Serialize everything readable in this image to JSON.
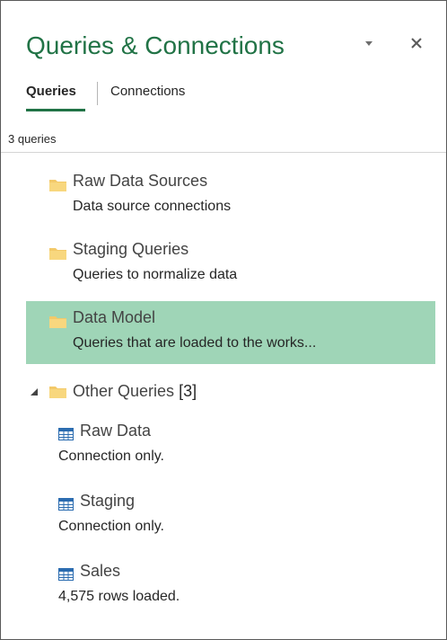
{
  "pane": {
    "title": "Queries & Connections",
    "dropdown_icon": "chevron-down-icon",
    "close_icon": "close-icon",
    "accent_color": "#217346",
    "selected_color": "#9fd5b7"
  },
  "tabs": {
    "queries_label": "Queries",
    "connections_label": "Connections",
    "active": "Queries"
  },
  "query_count": "3 queries",
  "groups": [
    {
      "name": "Raw Data Sources",
      "description": "Data source connections",
      "icon": "folder-icon",
      "selected": false
    },
    {
      "name": "Staging Queries",
      "description": "Queries to normalize data",
      "icon": "folder-icon",
      "selected": false
    },
    {
      "name": "Data Model",
      "description": "Queries that are loaded to the works...",
      "icon": "folder-icon",
      "selected": true
    }
  ],
  "other_group": {
    "name": "Other Queries",
    "count": "[3]",
    "expanded": true,
    "icon": "folder-icon"
  },
  "queries": [
    {
      "name": "Raw Data",
      "status": "Connection only.",
      "icon": "table-icon"
    },
    {
      "name": "Staging",
      "status": "Connection only.",
      "icon": "table-icon"
    },
    {
      "name": "Sales",
      "status": "4,575 rows loaded.",
      "icon": "table-icon"
    }
  ]
}
